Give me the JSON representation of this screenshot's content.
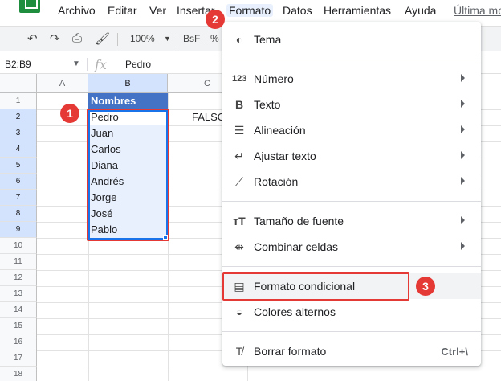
{
  "menubar": {
    "items": [
      "Archivo",
      "Editar",
      "Ver",
      "Insertar",
      "Formato",
      "Datos",
      "Herramientas",
      "Ayuda"
    ],
    "last_edit": "Última mo"
  },
  "toolbar": {
    "zoom": "100%",
    "font": "BsF",
    "percent": "%"
  },
  "formula_bar": {
    "name_box": "B2:B9",
    "fx": "fx",
    "value": "Pedro"
  },
  "grid": {
    "columns": [
      "A",
      "B",
      "C"
    ],
    "rows": [
      "1",
      "2",
      "3",
      "4",
      "5",
      "6",
      "7",
      "8",
      "9",
      "10",
      "11",
      "12",
      "13",
      "14",
      "15",
      "16",
      "17",
      "18"
    ],
    "header_cell": "Nombres",
    "names": [
      "Pedro",
      "Juan",
      "Carlos",
      "Diana",
      "Andrés",
      "Jorge",
      "José",
      "Pablo"
    ],
    "c2_value": "FALSO"
  },
  "format_menu": {
    "groups": [
      [
        {
          "label": "Tema",
          "icon": "palette-icon"
        }
      ],
      [
        {
          "label": "Número",
          "icon": "number-format-icon",
          "submenu": true
        },
        {
          "label": "Texto",
          "icon": "bold-icon",
          "submenu": true
        },
        {
          "label": "Alineación",
          "icon": "align-left-icon",
          "submenu": true
        },
        {
          "label": "Ajustar texto",
          "icon": "wrap-text-icon",
          "submenu": true
        },
        {
          "label": "Rotación",
          "icon": "text-rotation-icon",
          "submenu": true
        }
      ],
      [
        {
          "label": "Tamaño de fuente",
          "icon": "font-size-icon",
          "submenu": true
        },
        {
          "label": "Combinar celdas",
          "icon": "merge-cells-icon",
          "submenu": true
        }
      ],
      [
        {
          "label": "Formato condicional",
          "icon": "paint-roller-icon"
        },
        {
          "label": "Colores alternos",
          "icon": "color-fill-icon"
        }
      ],
      [
        {
          "label": "Borrar formato",
          "icon": "clear-format-icon",
          "shortcut": "Ctrl+\\"
        }
      ]
    ]
  },
  "annotations": [
    "1",
    "2",
    "3"
  ],
  "colors": {
    "header_fill": "#4472c4",
    "selection": "#1a73e8",
    "selection_fill": "#e8f0fe",
    "annotation_red": "#e53935",
    "logo_green": "#1e8e3e"
  }
}
